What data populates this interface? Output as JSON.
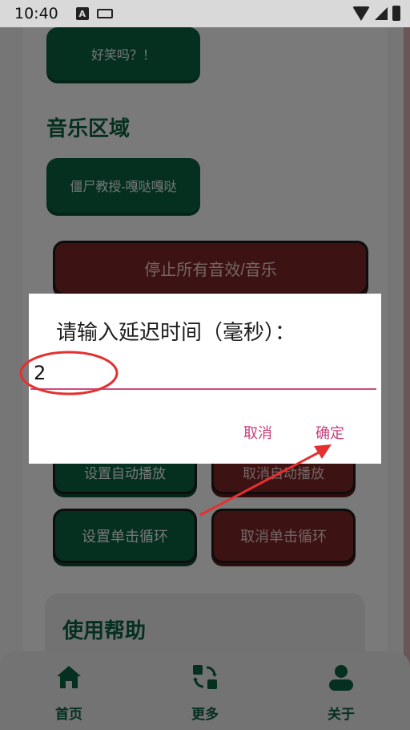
{
  "status_bar": {
    "time": "10:40"
  },
  "buttons": {
    "joke": "好笑吗？！",
    "zombie_prof": "僵尸教授-嘎哒嘎哒",
    "stop_all": "停止所有音效/音乐",
    "set_autoplay": "设置自动播放",
    "cancel_autoplay": "取消自动播放",
    "set_click_loop": "设置单击循环",
    "cancel_click_loop": "取消单击循环"
  },
  "sections": {
    "music": "音乐区域",
    "help": "使用帮助"
  },
  "dialog": {
    "title": "请输入延迟时间（毫秒）：",
    "input_value": "2",
    "cancel_label": "取消",
    "confirm_label": "确定"
  },
  "bottom_nav": {
    "items": [
      {
        "label": "首页",
        "icon": "home-icon"
      },
      {
        "label": "更多",
        "icon": "swap-icon"
      },
      {
        "label": "关于",
        "icon": "user-icon"
      }
    ]
  },
  "colors": {
    "primary_green": "#0a5f3e",
    "danger_red": "#7a2424",
    "dialog_accent": "#c4417b",
    "annotation_red": "#e53030"
  }
}
